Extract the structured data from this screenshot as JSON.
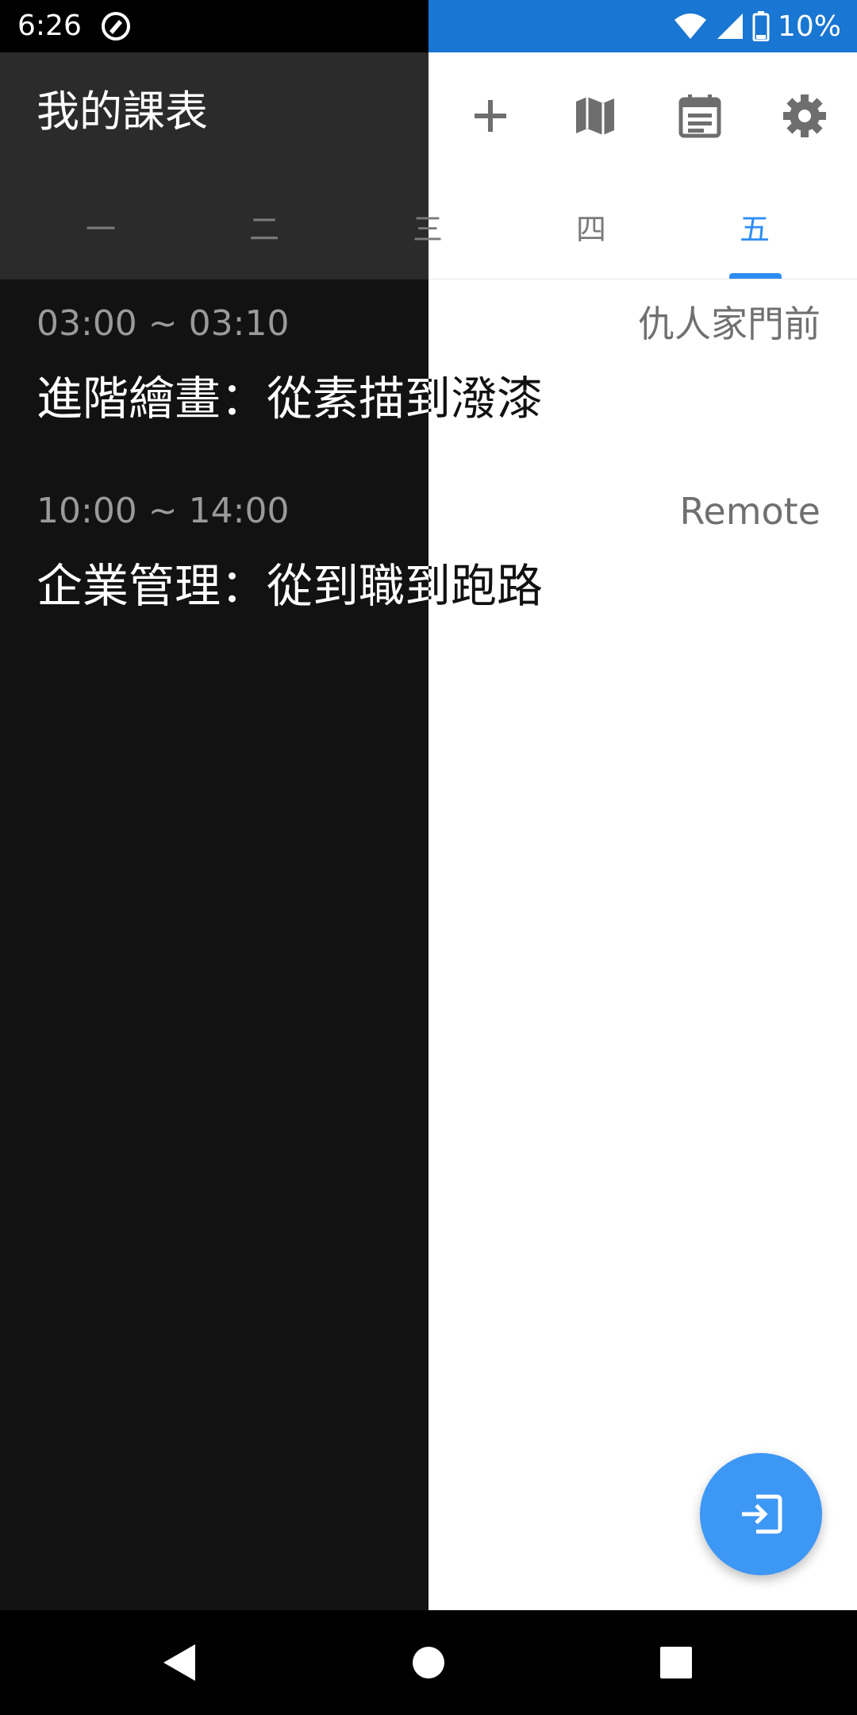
{
  "status_bar": {
    "time": "6:26",
    "battery": "10%",
    "icons": [
      "notification-app-icon",
      "wifi-icon",
      "signal-icon",
      "battery-icon"
    ]
  },
  "app_bar": {
    "title": "我的課表",
    "actions": [
      {
        "name": "add-icon"
      },
      {
        "name": "map-icon"
      },
      {
        "name": "calendar-icon"
      },
      {
        "name": "settings-icon"
      }
    ]
  },
  "tabs": [
    {
      "label": "一"
    },
    {
      "label": "二"
    },
    {
      "label": "三"
    },
    {
      "label": "四"
    },
    {
      "label": "五",
      "active": true
    }
  ],
  "courses": [
    {
      "time": "03:00 ~ 03:10",
      "location": "仇人家門前",
      "title": "進階繪畫：從素描到潑漆"
    },
    {
      "time": "10:00 ~ 14:00",
      "location": "Remote",
      "title": "企業管理：從到職到跑路"
    }
  ],
  "fab": {
    "icon": "login-icon"
  },
  "nav_bar": {
    "icons": [
      "back-icon",
      "home-icon",
      "recents-icon"
    ]
  },
  "colors": {
    "accent": "#2E8DF5",
    "status_bar": "#1976D2",
    "fab": "#3D97F5"
  }
}
